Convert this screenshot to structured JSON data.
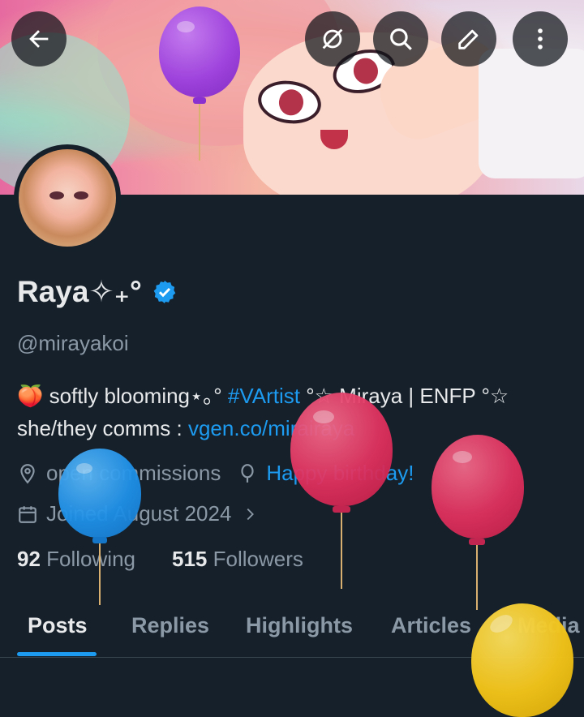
{
  "header": {
    "back_icon": "arrow-left-icon",
    "actions": [
      "sync-off-icon",
      "search-icon",
      "edit-icon",
      "more-icon"
    ]
  },
  "profile": {
    "name": "Raya✧₊°",
    "verified": true,
    "handle": "@mirayakoi",
    "bio_line1_prefix": "🍑 softly blooming⋆｡° ",
    "bio_hashtag": "#VArtist",
    "bio_line1_suffix": " °☆ Miraya | ENFP °☆",
    "bio_line2_prefix": "she/they comms : ",
    "bio_link": "vgen.co/mirairaya",
    "location": "open commissions",
    "birthday": "Happy birthday!",
    "joined": "Joined August 2024",
    "following_count": "92",
    "following_label": "Following",
    "followers_count": "515",
    "followers_label": "Followers"
  },
  "tabs": [
    "Posts",
    "Replies",
    "Highlights",
    "Articles",
    "Media"
  ],
  "active_tab": "Posts",
  "colors": {
    "background": "#15202b",
    "accent": "#1d9bf0",
    "muted": "#8b98a5",
    "balloon_purple": "#9b3fe0",
    "balloon_red": "#e0305e",
    "balloon_blue": "#1e90e8",
    "balloon_yellow": "#f2c418"
  }
}
